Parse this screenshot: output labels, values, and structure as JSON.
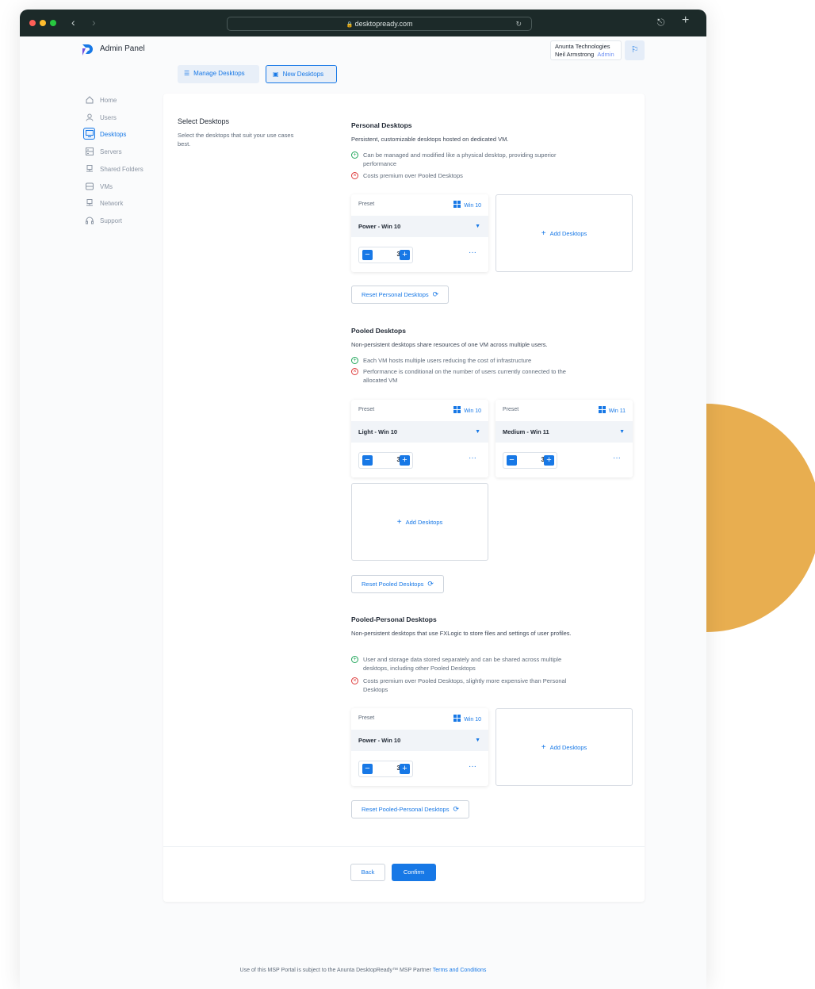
{
  "browser": {
    "url": "desktopready.com",
    "back_icon": "chevron-left-icon",
    "forward_icon": "chevron-right-icon",
    "share_icon": "share-icon",
    "new_tab_icon": "plus-icon"
  },
  "app": {
    "title": "Admin Panel",
    "company": "Anunta Technologies",
    "user_name": "Neil Armstrong",
    "user_role": "Admin",
    "accent_color": "#1778e6"
  },
  "top_tabs": {
    "manage": "Manage Desktops",
    "new": "New Desktops"
  },
  "sidebar": {
    "items": [
      {
        "label": "Home",
        "icon": "home-icon"
      },
      {
        "label": "Users",
        "icon": "user-icon"
      },
      {
        "label": "Desktops",
        "icon": "monitor-icon",
        "active": true
      },
      {
        "label": "Servers",
        "icon": "server-icon"
      },
      {
        "label": "Shared Folders",
        "icon": "shared-folder-icon"
      },
      {
        "label": "VMs",
        "icon": "vm-icon"
      },
      {
        "label": "Network",
        "icon": "network-icon"
      },
      {
        "label": "Support",
        "icon": "headset-icon"
      }
    ]
  },
  "select": {
    "title": "Select Desktops",
    "description": "Select the desktops that suit your use cases best."
  },
  "common": {
    "preset_label": "Preset",
    "add_desktops": "Add Desktops",
    "more": "···"
  },
  "personal": {
    "title": "Personal Desktops",
    "description": "Persistent, customizable desktops hosted on dedicated VM.",
    "pros": [
      "Can be managed and modified like a physical desktop, providing superior performance"
    ],
    "cons": [
      "Costs premium over Pooled Desktops"
    ],
    "cards": [
      {
        "os": "Win 10",
        "preset": "Power - Win 10",
        "count": "3"
      }
    ],
    "reset_label": "Reset Personal Desktops"
  },
  "pooled": {
    "title": "Pooled Desktops",
    "description": "Non-persistent desktops share resources of one VM across multiple users.",
    "pros": [
      "Each VM hosts multiple users reducing the cost of infrastructure"
    ],
    "cons": [
      "Performance is conditional on the number of users currently connected to the allocated VM"
    ],
    "cards": [
      {
        "os": "Win 10",
        "preset": "Light - Win 10",
        "count": "3"
      },
      {
        "os": "Win 11",
        "preset": "Medium - Win 11",
        "count": "3"
      }
    ],
    "reset_label": "Reset Pooled Desktops"
  },
  "pooled_personal": {
    "title": "Pooled-Personal Desktops",
    "description": "Non-persistent desktops that use FXLogic to store files and settings of user profiles.",
    "pros": [
      "User and storage data stored separately and can be shared across multiple desktops, including other Pooled Desktops"
    ],
    "cons": [
      "Costs premium over Pooled Desktops, slightly more expensive than Personal Desktops"
    ],
    "cards": [
      {
        "os": "Win 10",
        "preset": "Power - Win 10",
        "count": "3"
      }
    ],
    "reset_label": "Reset Pooled-Personal Desktops"
  },
  "actions": {
    "back": "Back",
    "confirm": "Confirm"
  },
  "footer": {
    "text": "Use of this MSP Portal is subject to the Anunta DesktopReady™ MSP Partner ",
    "link": "Terms and Conditions"
  }
}
